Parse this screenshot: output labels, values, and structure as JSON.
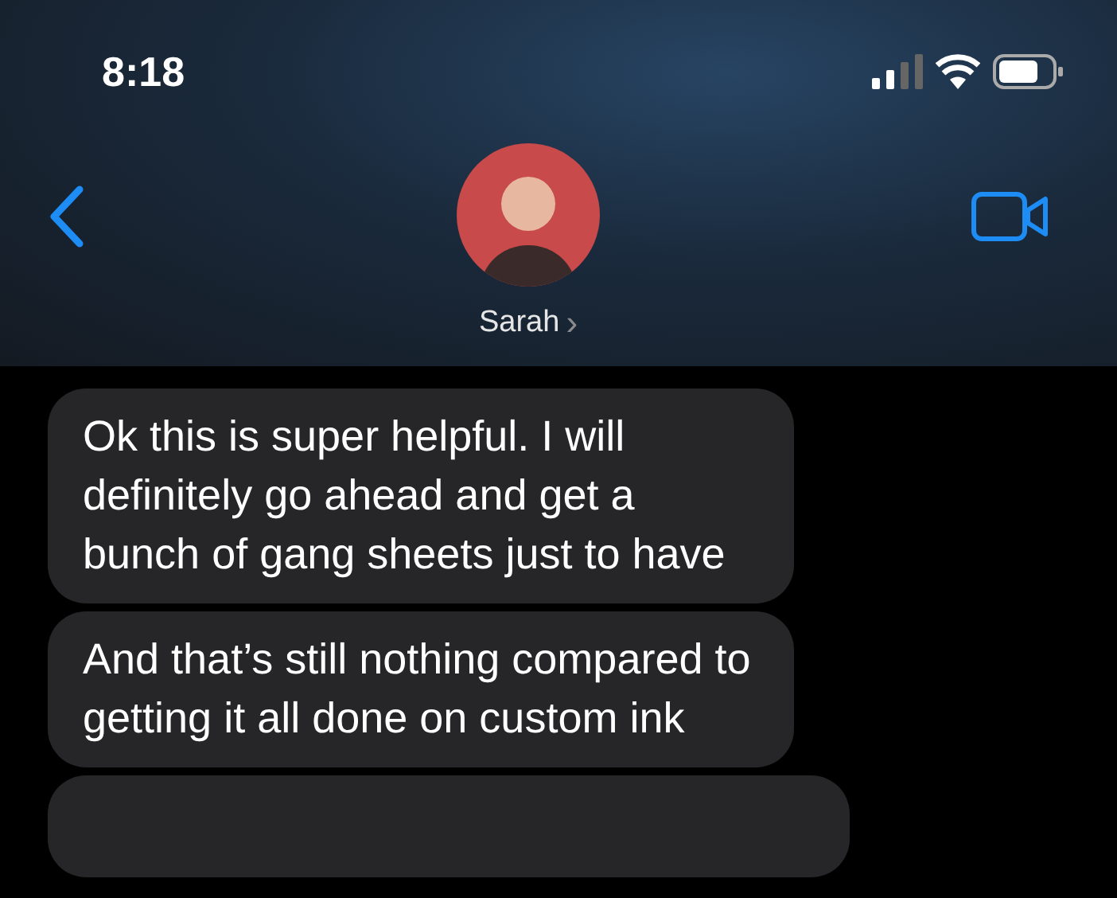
{
  "status_bar": {
    "time": "8:18"
  },
  "header": {
    "contact_name": "Sarah",
    "chevron": "›"
  },
  "messages": [
    {
      "text": "Ok this is super helpful. I will definitely go ahead and get a bunch of gang sheets just to have"
    },
    {
      "text": "And that’s still nothing compared to getting it all done on custom ink"
    },
    {
      "kind": "cut_off"
    }
  ]
}
